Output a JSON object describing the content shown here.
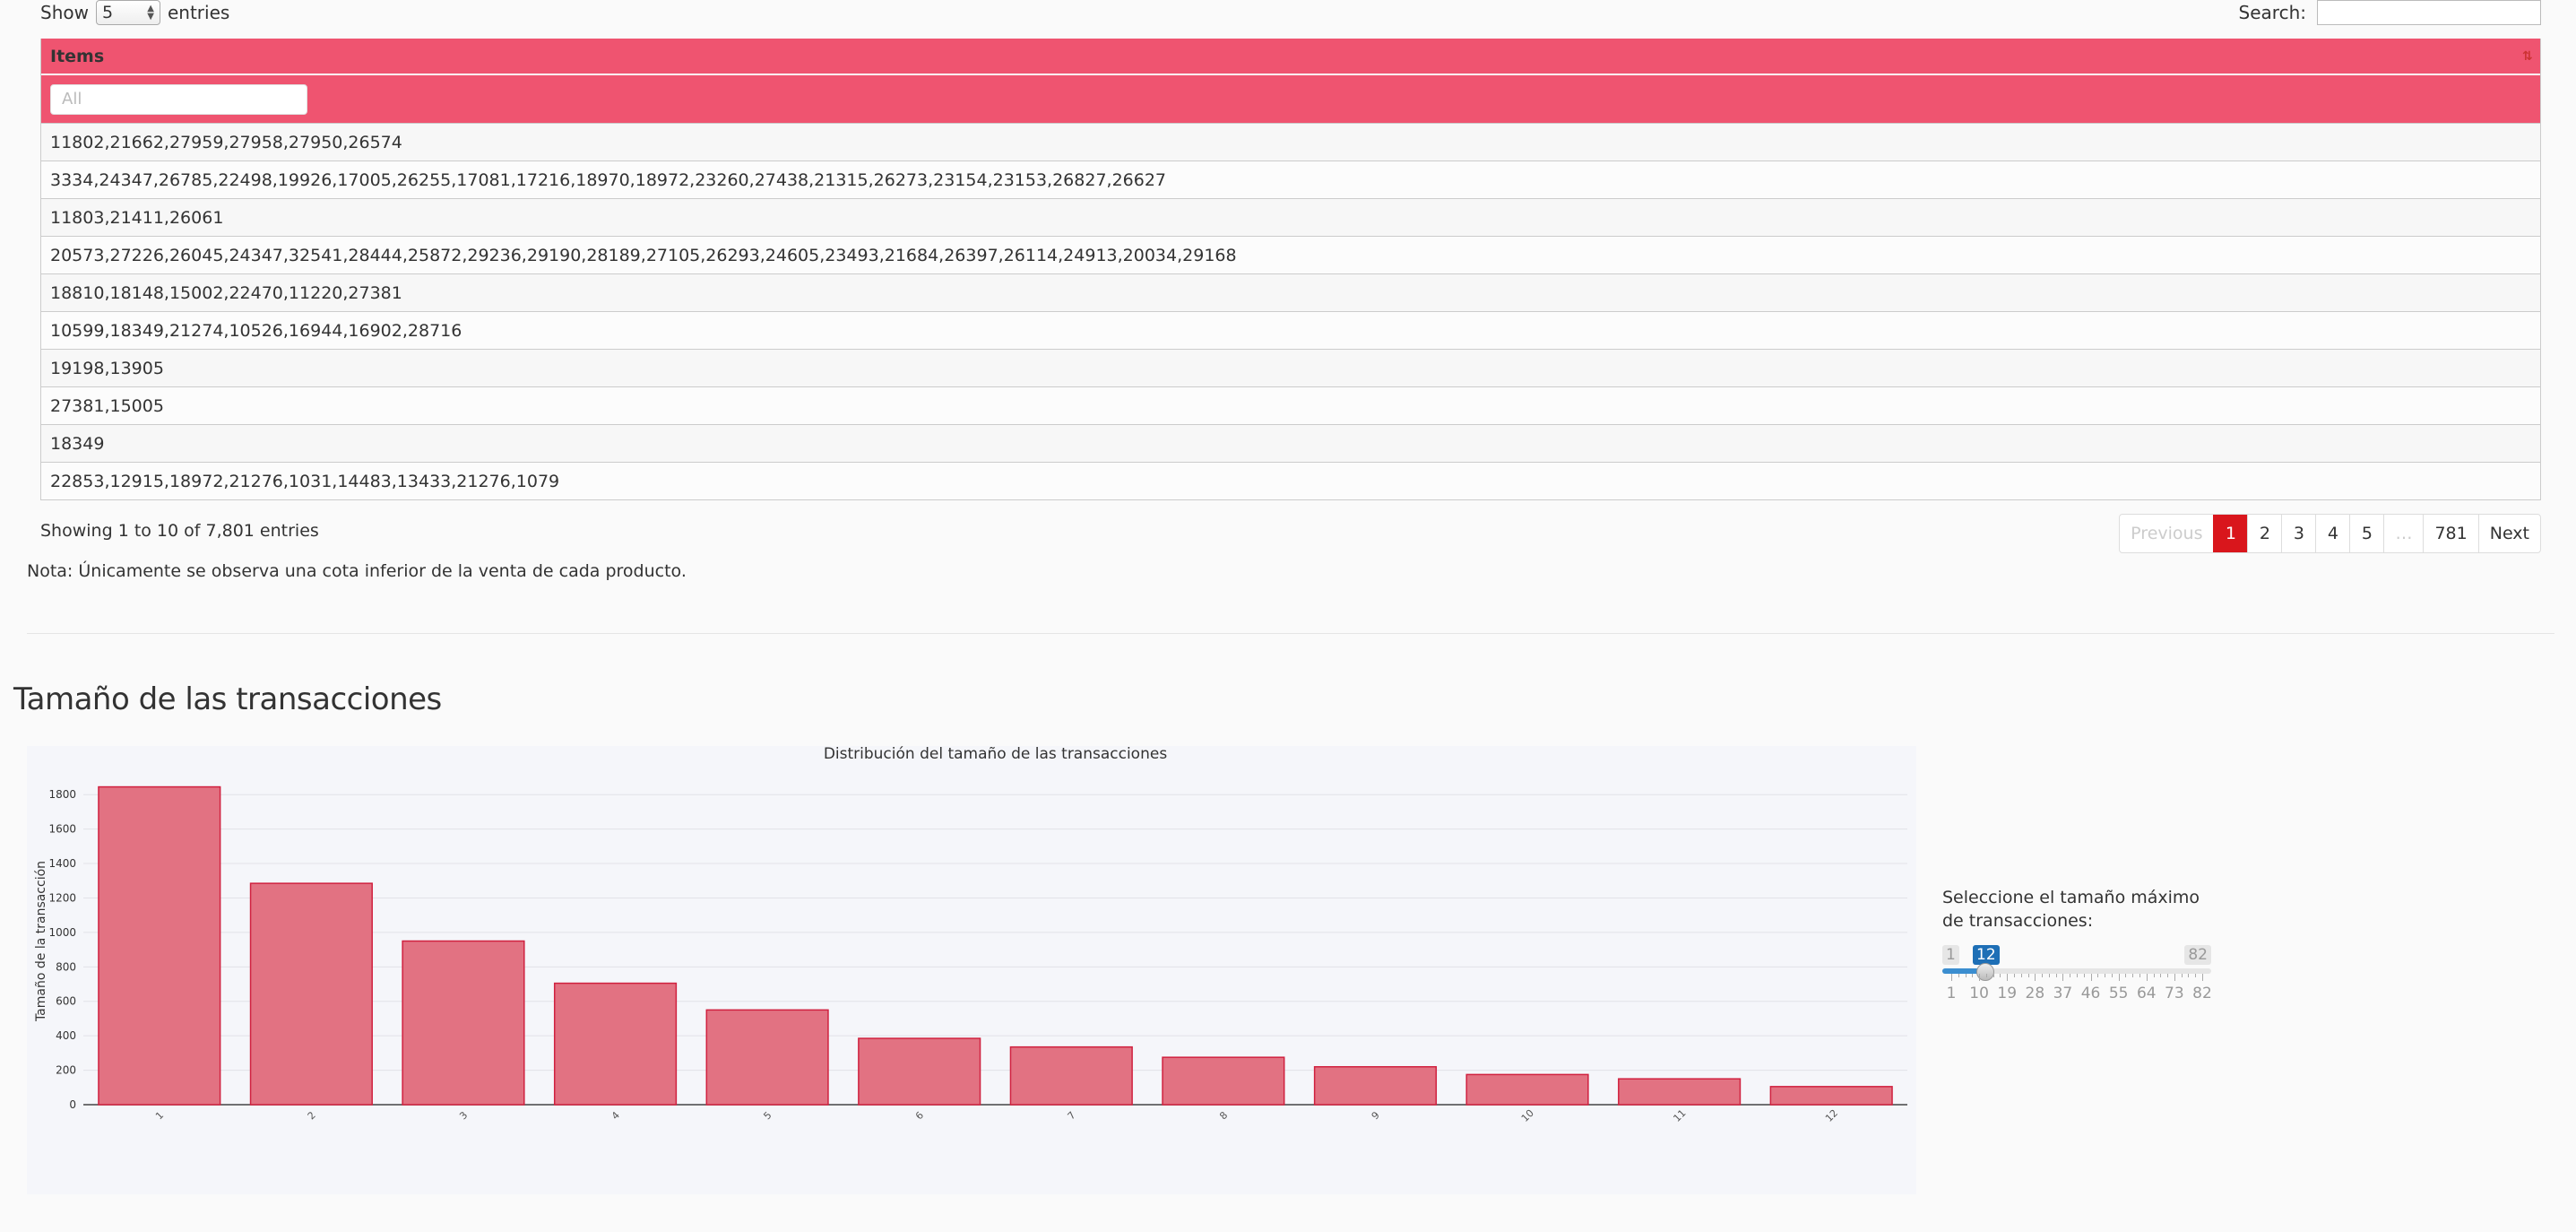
{
  "controls": {
    "show_label": "Show",
    "length_value": "5",
    "entries_label": "entries",
    "search_label": "Search:",
    "search_value": ""
  },
  "table": {
    "column_header": "Items",
    "filter_placeholder": "All",
    "rows": [
      "11802,21662,27959,27958,27950,26574",
      "3334,24347,26785,22498,19926,17005,26255,17081,17216,18970,18972,23260,27438,21315,26273,23154,23153,26827,26627",
      "11803,21411,26061",
      "20573,27226,26045,24347,32541,28444,25872,29236,29190,28189,27105,26293,24605,23493,21684,26397,26114,24913,20034,29168",
      "18810,18148,15002,22470,11220,27381",
      "10599,18349,21274,10526,16944,16902,28716",
      "19198,13905",
      "27381,15005",
      "18349",
      "22853,12915,18972,21276,1031,14483,13433,21276,1079"
    ]
  },
  "info": "Showing 1 to 10 of 7,801 entries",
  "pagination": {
    "previous": "Previous",
    "pages": [
      "1",
      "2",
      "3",
      "4",
      "5",
      "…",
      "781"
    ],
    "active": "1",
    "next": "Next"
  },
  "note": "Nota: Únicamente se observa una cota inferior de la venta de cada producto.",
  "section_title": "Tamaño de las transacciones",
  "chart_data": {
    "type": "bar",
    "title": "Distribución del tamaño de las transacciones",
    "xlabel": "",
    "ylabel": "Tamaño de la transacción",
    "categories": [
      "1",
      "2",
      "3",
      "4",
      "5",
      "6",
      "7",
      "8",
      "9",
      "10",
      "11",
      "12"
    ],
    "values": [
      1845,
      1285,
      950,
      705,
      550,
      385,
      335,
      275,
      220,
      175,
      150,
      105
    ],
    "ylim": [
      0,
      1900
    ],
    "yticks": [
      0,
      200,
      400,
      600,
      800,
      1000,
      1200,
      1400,
      1600,
      1800
    ],
    "grid": true,
    "bar_color": "#e27282",
    "bar_border": "#d0213f",
    "background": "#f5f6fa"
  },
  "slider": {
    "label": "Seleccione el tamaño máximo de transacciones:",
    "min": 1,
    "max": 82,
    "value": 12,
    "min_label": "1",
    "max_label": "82",
    "value_label": "12",
    "grid_labels": [
      "1",
      "10",
      "19",
      "28",
      "37",
      "46",
      "55",
      "64",
      "73",
      "82"
    ]
  },
  "colors": {
    "accent": "#ef5470",
    "active_page": "#d9161c",
    "slider_blue": "#1e6fb6"
  }
}
